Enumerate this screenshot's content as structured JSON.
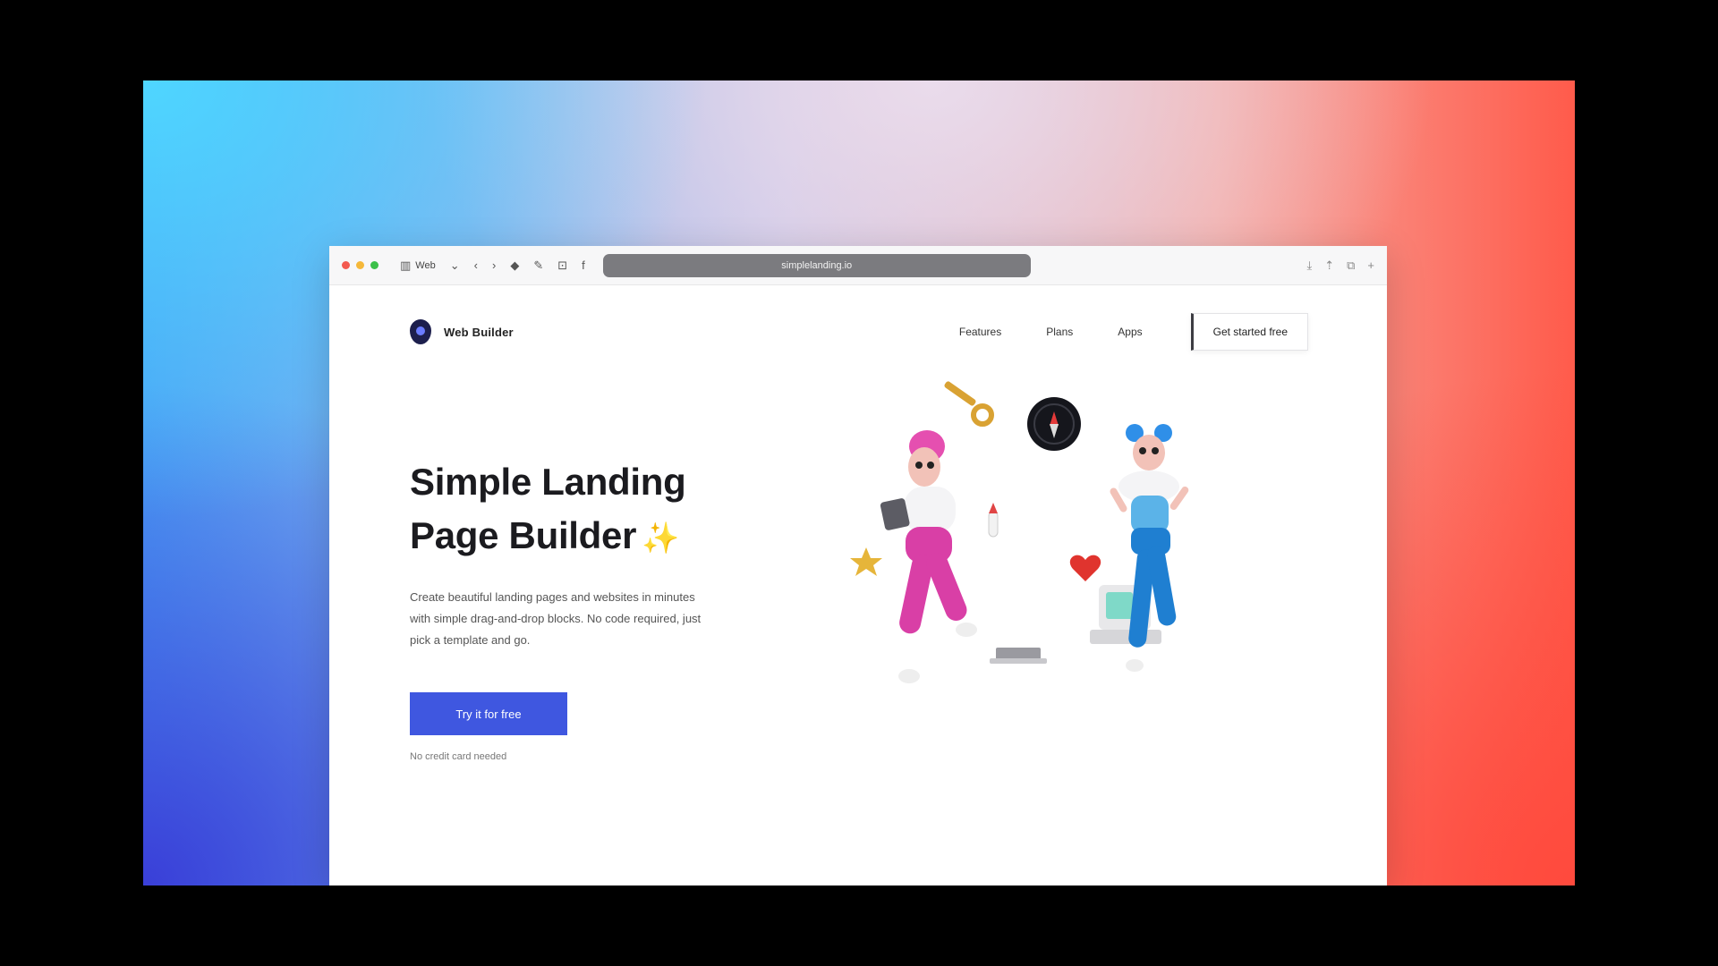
{
  "browser": {
    "toolbar_label": "Web",
    "url": "simplelanding.io"
  },
  "nav": {
    "brand": "Web Builder",
    "links": [
      "Features",
      "Plans",
      "Apps"
    ],
    "cta": "Get started free"
  },
  "hero": {
    "title_line1": "Simple Landing",
    "title_line2": "Page Builder",
    "sparkle": "✨",
    "description": "Create beautiful landing pages and websites in minutes with simple drag-and-drop blocks. No code required, just pick a template and go.",
    "button": "Try it for free",
    "note": "No credit card needed"
  },
  "colors": {
    "accent": "#3f57e0",
    "window_close": "#f35a50",
    "window_minimize": "#f5b83a",
    "window_zoom": "#3cc04a"
  }
}
